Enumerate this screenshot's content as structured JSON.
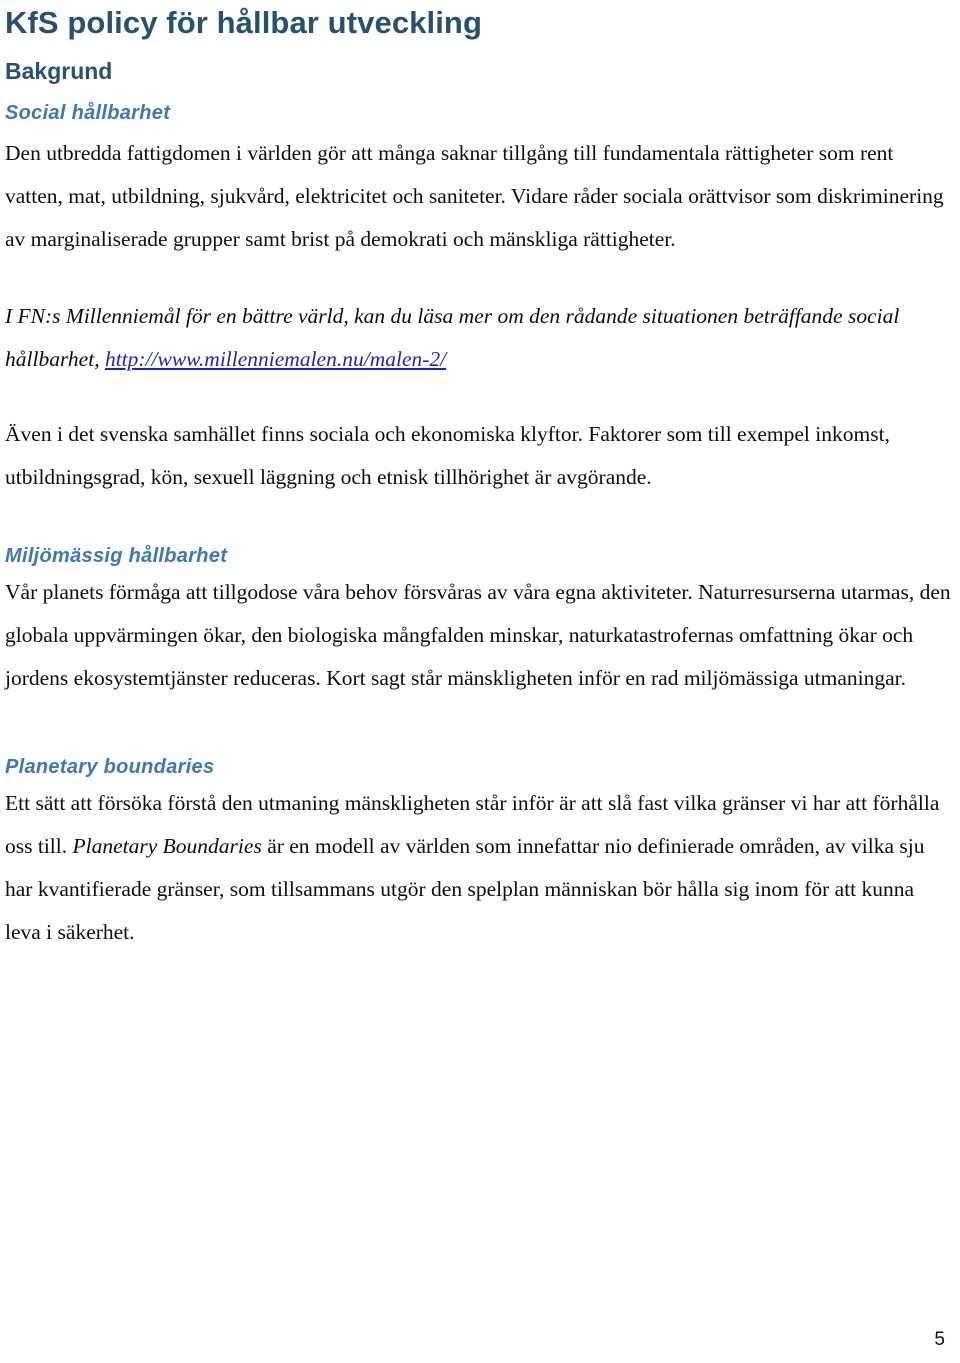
{
  "document": {
    "title": "KfS policy för hållbar utveckling",
    "page_number": "5",
    "colors": {
      "title_blue": "#27526f",
      "subheading_blue": "#3d78b4",
      "link_blue": "#2222bb",
      "body_text": "#0d0d0d",
      "background": "#ffffff"
    },
    "sections": {
      "bakgrund": {
        "heading": "Bakgrund",
        "social": {
          "heading": "Social hållbarhet",
          "paragraph_1": "Den utbredda fattigdomen i världen gör att många saknar tillgång till fundamentala rättigheter som rent vatten, mat, utbildning, sjukvård, elektricitet och saniteter. Vidare råder sociala orättvisor som diskriminering av marginaliserade grupper samt brist på demokrati och mänskliga rättigheter.",
          "paragraph_2_lead": "I FN:s Millenniemål för en bättre värld, kan du läsa mer om den rådande situationen beträffande social hållbarhet, ",
          "paragraph_2_link": "http://www.millenniemalen.nu/malen-2/",
          "paragraph_3": "Även i det svenska samhället finns sociala och ekonomiska klyftor. Faktorer som till exempel inkomst, utbildningsgrad, kön, sexuell läggning och etnisk tillhörighet är avgörande."
        },
        "miljomassig": {
          "heading": "Miljömässig hållbarhet",
          "paragraph_1": "Vår planets förmåga att tillgodose våra behov försvåras av våra egna aktiviteter. Naturresurserna utarmas, den globala uppvärmingen ökar, den biologiska mångfalden minskar, naturkatastrofernas omfattning ökar och jordens ekosystemtjänster reduceras. Kort sagt står mänskligheten inför en rad miljömässiga utmaningar."
        },
        "planetary": {
          "heading": "Planetary boundaries",
          "paragraph_1_part_1": "Ett sätt att försöka förstå den utmaning mänskligheten står inför är att slå fast vilka gränser vi har att förhålla oss till. ",
          "paragraph_1_emphasis": "Planetary Boundaries",
          "paragraph_1_part_2": " är en modell av världen som innefattar nio definierade områden, av vilka sju har kvantifierade gränser, som tillsammans utgör den spelplan människan bör hålla sig inom för att kunna leva i säkerhet."
        }
      }
    }
  }
}
